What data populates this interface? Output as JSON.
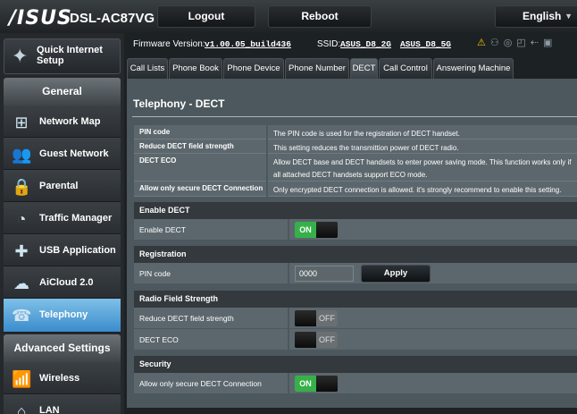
{
  "header": {
    "logo": "/ISUS",
    "model": "DSL-AC87VG",
    "logout": "Logout",
    "reboot": "Reboot",
    "language": "English"
  },
  "firmware": {
    "label": "Firmware Version:",
    "version": "v1.00.05_build436",
    "ssid_label": "SSID:",
    "ssid_2g": "ASUS_D8_2G",
    "ssid_5g": "ASUS_D8_5G"
  },
  "sidebar": {
    "qis": "Quick Internet Setup",
    "general": "General",
    "items": [
      {
        "label": "Network Map",
        "icon": "network-map-icon"
      },
      {
        "label": "Guest Network",
        "icon": "guest-network-icon"
      },
      {
        "label": "Parental Controls",
        "icon": "parental-controls-icon"
      },
      {
        "label": "Traffic Manager",
        "icon": "traffic-manager-icon"
      },
      {
        "label": "USB Application",
        "icon": "usb-application-icon"
      },
      {
        "label": "AiCloud 2.0",
        "icon": "aicloud-icon"
      },
      {
        "label": "Telephony",
        "icon": "telephony-icon"
      }
    ],
    "advanced": "Advanced Settings",
    "advanced_items": [
      {
        "label": "Wireless",
        "icon": "wireless-icon"
      },
      {
        "label": "LAN",
        "icon": "lan-icon"
      }
    ]
  },
  "tabs": [
    "Call Lists",
    "Phone Book",
    "Phone Device",
    "Phone Number",
    "DECT",
    "Call Control",
    "Answering Machine"
  ],
  "page": {
    "title": "Telephony - DECT",
    "info": [
      {
        "k": "PIN code",
        "v": "The PIN code is used for the registration of DECT handset."
      },
      {
        "k": "Reduce DECT field strength",
        "v": "This setting reduces the transmittion power of DECT radio."
      },
      {
        "k": "DECT ECO",
        "v": "Allow DECT base and DECT handsets to enter power saving mode. This function works only if all attached DECT handsets support ECO mode."
      },
      {
        "k": "Allow only secure DECT Connection",
        "v": "Only encrypted DECT connection is allowed. it's strongly recommend to enable this setting."
      }
    ],
    "sections": {
      "enable": "Enable DECT",
      "registration": "Registration",
      "radio": "Radio Field Strength",
      "security": "Security"
    },
    "fields": {
      "enable_dect": "Enable DECT",
      "pin_code": "PIN code",
      "pin_value": "0000",
      "apply": "Apply",
      "reduce": "Reduce DECT field strength",
      "eco": "DECT ECO",
      "secure": "Allow only secure DECT Connection"
    },
    "toggle": {
      "on": "ON",
      "off": "OFF"
    },
    "states": {
      "enable_dect": "on",
      "reduce": "off",
      "eco": "off",
      "secure": "on"
    }
  }
}
